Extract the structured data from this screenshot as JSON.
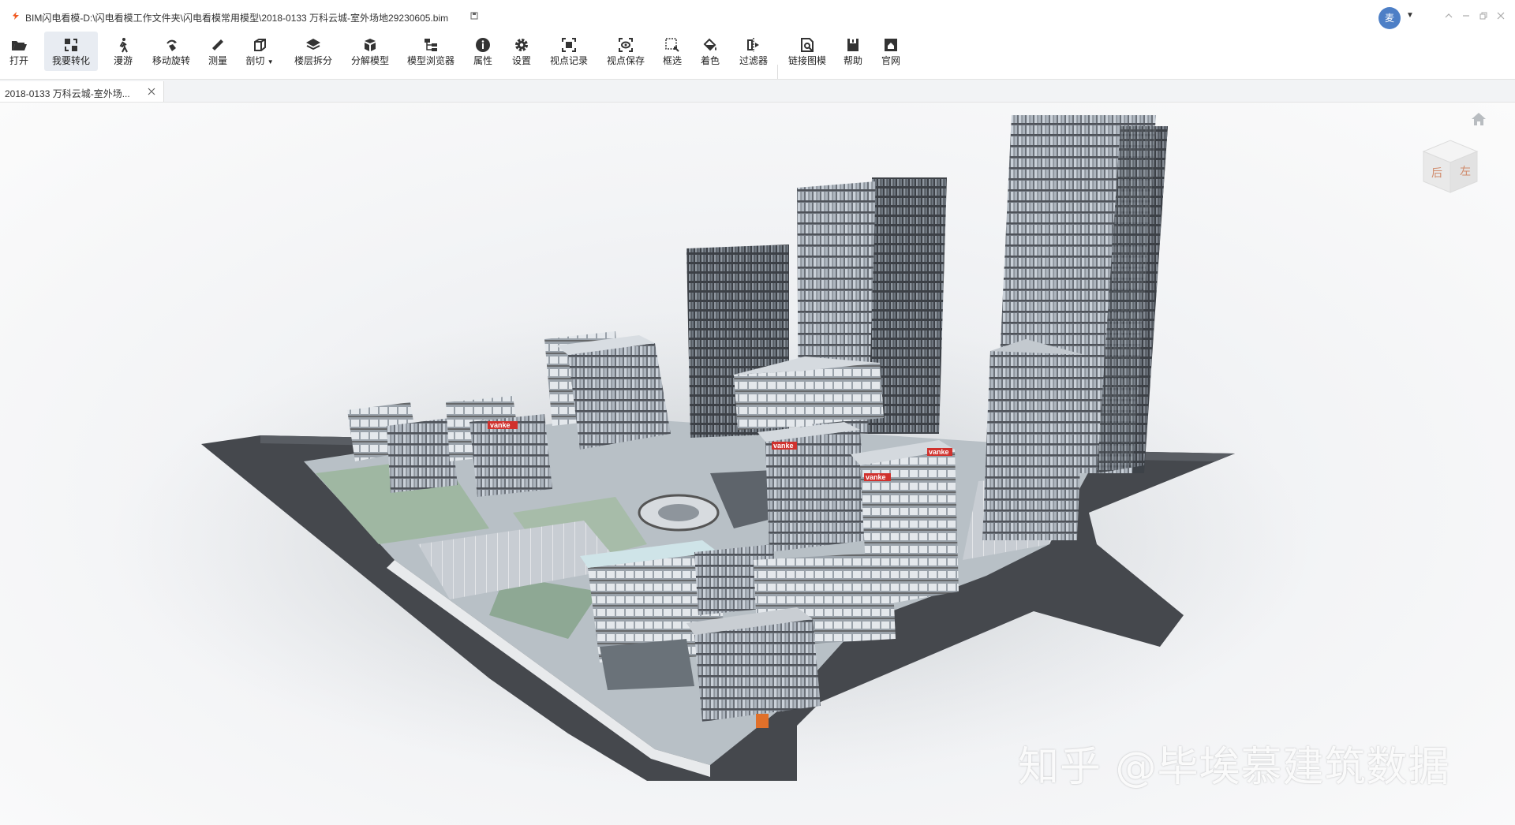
{
  "window": {
    "title": "BIM闪电看模-D:\\闪电看模工作文件夹\\闪电看模常用模型\\2018-0133 万科云城-室外场地29230605.bim",
    "avatar_text": "麦"
  },
  "toolbar": {
    "items": [
      {
        "label": "打开",
        "icon": "folder-open-icon"
      },
      {
        "label": "我要转化",
        "icon": "convert-icon"
      },
      {
        "label": "漫游",
        "icon": "walk-icon"
      },
      {
        "label": "移动旋转",
        "icon": "rotate-icon"
      },
      {
        "label": "测量",
        "icon": "ruler-icon"
      },
      {
        "label": "剖切",
        "icon": "section-box-icon"
      },
      {
        "label": "楼层拆分",
        "icon": "layers-icon"
      },
      {
        "label": "分解模型",
        "icon": "explode-icon"
      },
      {
        "label": "模型浏览器",
        "icon": "tree-icon"
      },
      {
        "label": "属性",
        "icon": "info-icon"
      },
      {
        "label": "设置",
        "icon": "gear-icon"
      },
      {
        "label": "视点记录",
        "icon": "viewpoint-record-icon"
      },
      {
        "label": "视点保存",
        "icon": "viewpoint-save-icon"
      },
      {
        "label": "框选",
        "icon": "box-select-icon"
      },
      {
        "label": "着色",
        "icon": "paint-bucket-icon"
      },
      {
        "label": "过滤器",
        "icon": "filter-icon"
      },
      {
        "label": "链接图模",
        "icon": "link-drawing-icon"
      },
      {
        "label": "帮助",
        "icon": "help-icon"
      },
      {
        "label": "官网",
        "icon": "website-icon"
      }
    ],
    "active_item": "我要转化"
  },
  "tabs": [
    {
      "label": "2018-0133 万科云城-室外场...",
      "active": true
    }
  ],
  "viewport": {
    "watermark": "知乎 @毕埃慕建筑数据",
    "signage": "vanke",
    "viewcube_faces": [
      "后",
      "左"
    ]
  },
  "colors": {
    "accent": "#4d7fc6",
    "signage": "#d0312d",
    "road": "#4a4d52"
  }
}
